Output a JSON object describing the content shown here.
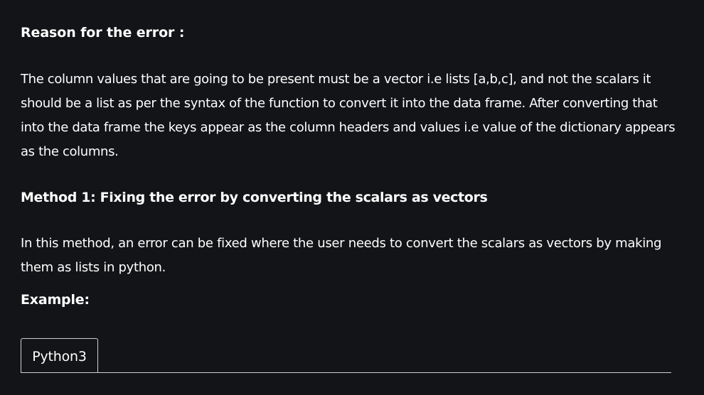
{
  "article": {
    "reason_heading": "Reason for the error :",
    "reason_paragraph": "The column values that are going to be present must be a vector i.e lists [a,b,c], and not the scalars it should be a list as per the syntax of the function to convert it into the data frame. After converting that into the data frame the keys appear as the column headers and values i.e value of the dictionary appears as the columns.",
    "method_heading": "Method 1: Fixing the error by converting the scalars as vectors",
    "method_paragraph": "In this method, an error can be fixed where the user needs to convert the scalars as vectors by making them as lists in python.",
    "example_label": "Example:"
  },
  "code_block": {
    "tabs": [
      "Python3"
    ],
    "active_tab": "Python3"
  },
  "colors": {
    "background": "#131417",
    "text": "#ffffff",
    "border": "#d0d0d0"
  }
}
